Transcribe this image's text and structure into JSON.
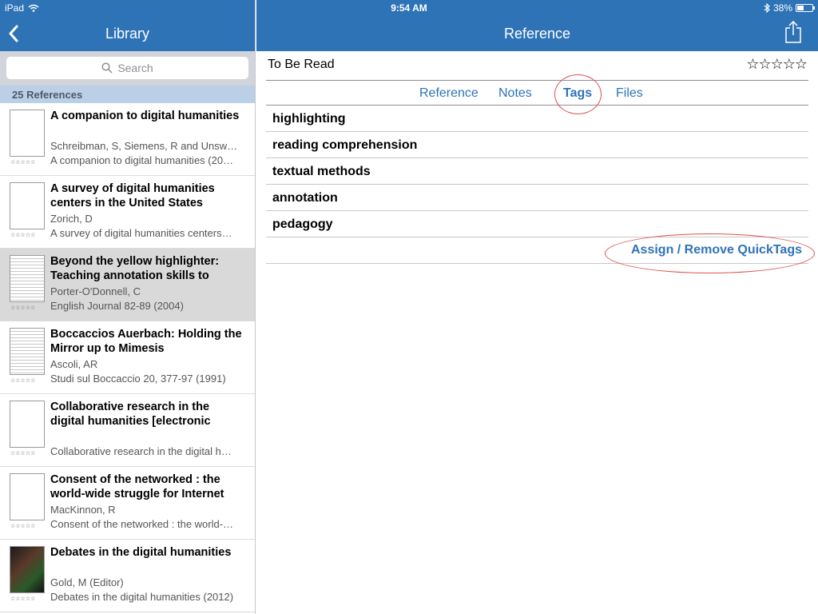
{
  "status_bar": {
    "device": "iPad",
    "time": "9:54 AM",
    "battery": "38%"
  },
  "library": {
    "title": "Library",
    "search_placeholder": "Search",
    "section_header": "25 References",
    "items": [
      {
        "title": "A companion to digital humanities",
        "author": "Schreibman, S, Siemens, R and Unsw…",
        "source": "A companion to digital humanities (20…",
        "rating": "☆☆☆☆☆"
      },
      {
        "title": "A survey of digital humanities centers in the United States",
        "author": "Zorich, D",
        "source": "A survey of digital humanities centers…",
        "rating": "☆☆☆☆☆"
      },
      {
        "title": "Beyond the yellow highlighter: Teaching annotation skills to",
        "author": "Porter-O'Donnell, C",
        "source": "English Journal 82-89 (2004)",
        "rating": "☆☆☆☆☆"
      },
      {
        "title": "Boccaccios Auerbach: Holding the Mirror up to Mimesis",
        "author": "Ascoli, AR",
        "source": "Studi sul Boccaccio 20, 377-97 (1991)",
        "rating": "☆☆☆☆☆"
      },
      {
        "title": "Collaborative research in the digital humanities [electronic",
        "author": "",
        "source": "Collaborative research in the digital h…",
        "rating": "☆☆☆☆☆"
      },
      {
        "title": "Consent of the networked : the world-wide struggle for Internet",
        "author": "MacKinnon, R",
        "source": "Consent of the networked : the world-…",
        "rating": "☆☆☆☆☆"
      },
      {
        "title": "Debates in the digital humanities",
        "author": "Gold, M (Editor)",
        "source": "Debates in the digital humanities (2012)",
        "rating": "☆☆☆☆☆"
      }
    ]
  },
  "reference": {
    "title": "Reference",
    "status": "To Be Read",
    "rating": "☆☆☆☆☆",
    "tabs": [
      "Reference",
      "Notes",
      "Tags",
      "Files"
    ],
    "active_tab": "Tags",
    "tags": [
      "highlighting",
      "reading comprehension",
      "textual methods",
      "annotation",
      "pedagogy"
    ],
    "quicktags_label": "Assign / Remove QuickTags"
  },
  "colors": {
    "nav_blue": "#2f73b7",
    "annotation_red": "#d9534f"
  }
}
